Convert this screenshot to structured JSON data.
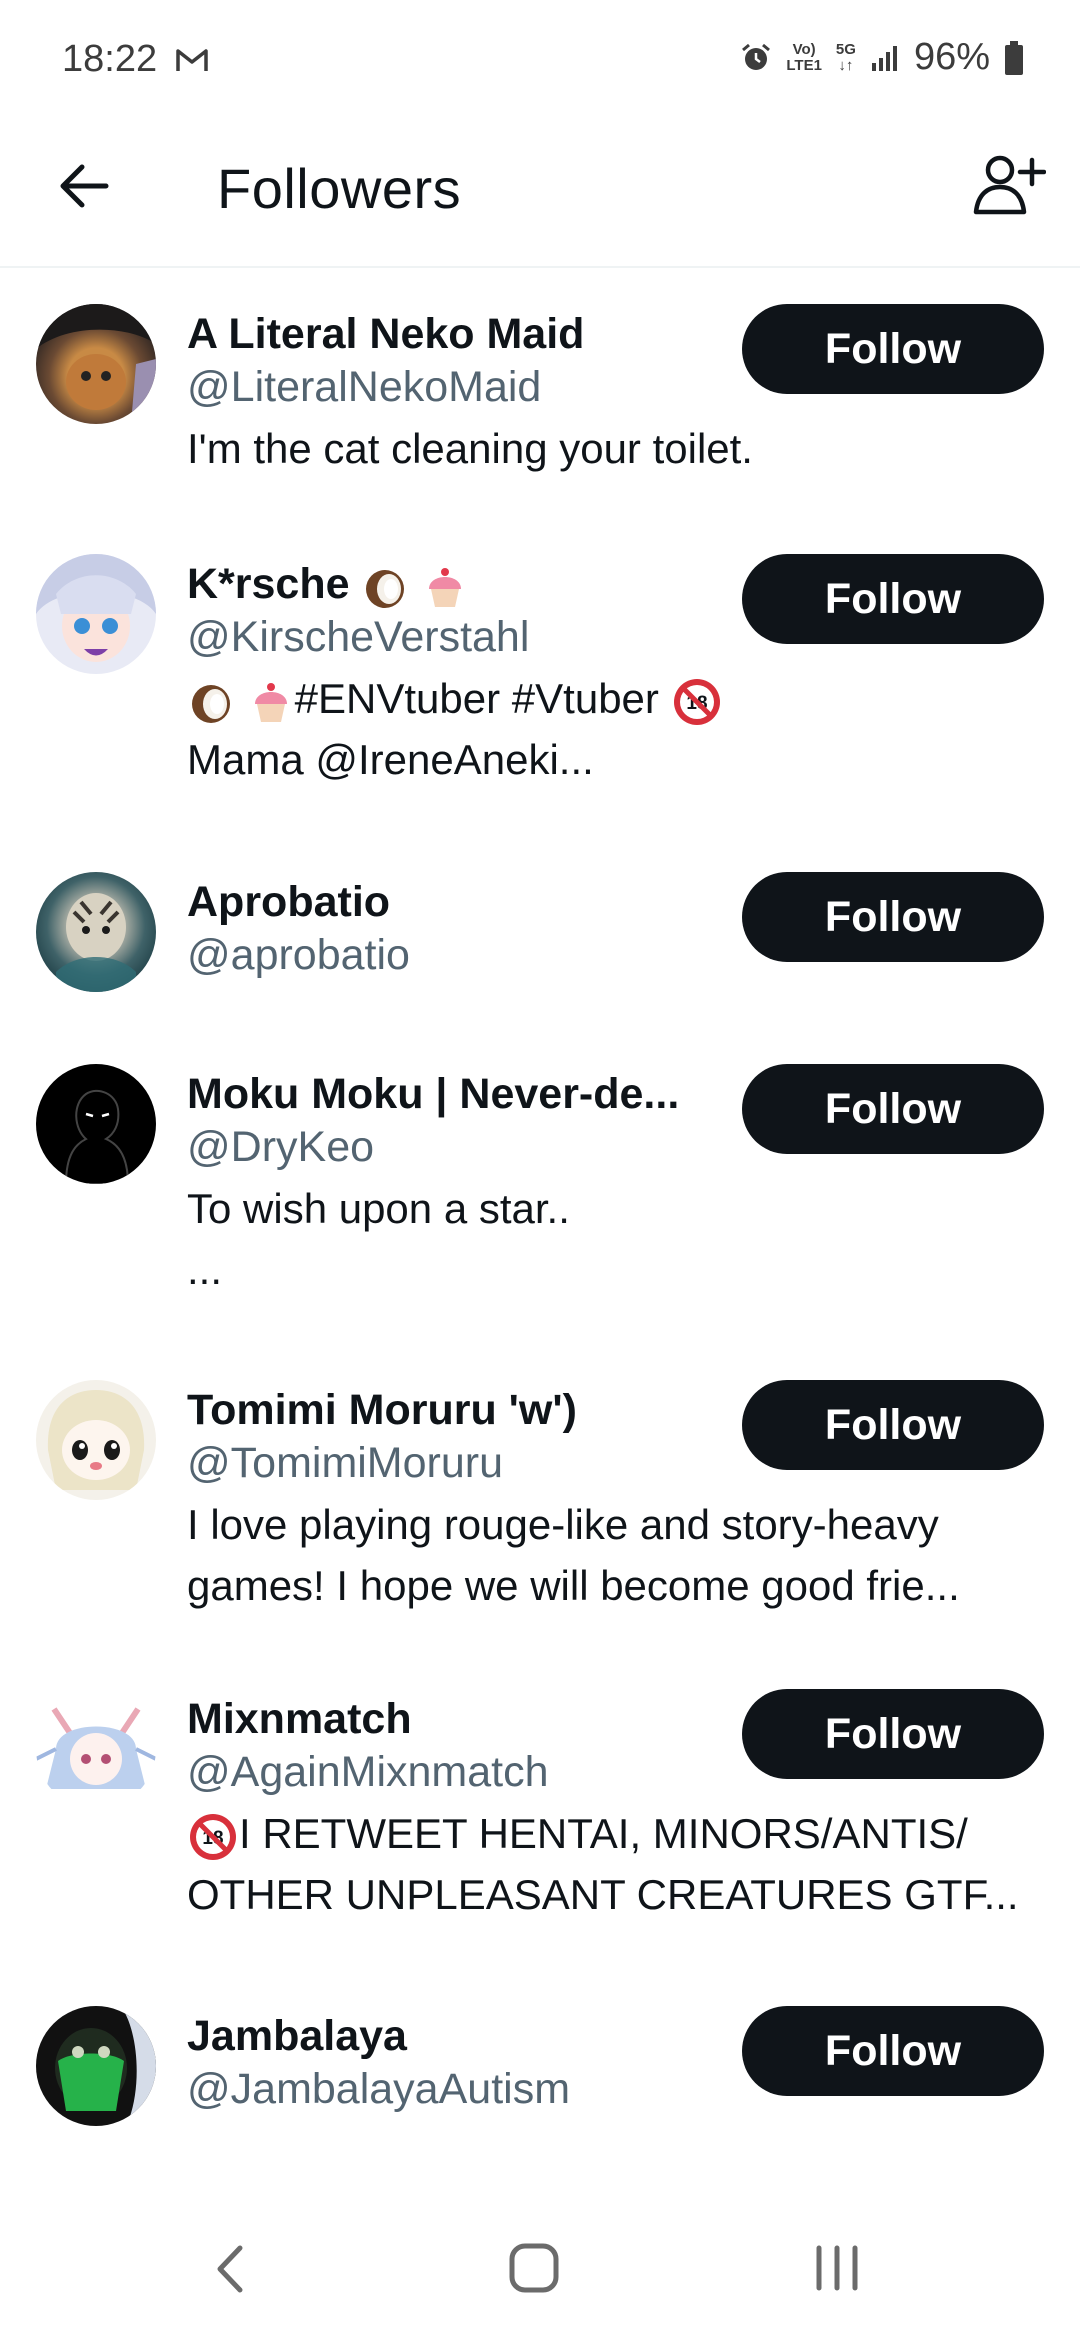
{
  "status_bar": {
    "time": "18:22",
    "volte": "Vo)\nLTE1",
    "network": "5G",
    "battery": "96%"
  },
  "header": {
    "title": "Followers",
    "back_icon": "arrow-left-icon",
    "action_icon": "add-user-icon"
  },
  "follow_label": "Follow",
  "followers": [
    {
      "name": "A Literal Neko Maid",
      "handle": "@LiteralNekoMaid",
      "bio": [
        "I'm the cat cleaning your toilet."
      ]
    },
    {
      "name": "K*rsche",
      "handle": "@KirscheVerstahl",
      "bio_line1": "#ENVtuber #Vtuber",
      "bio_line2": "Mama @IreneAneki..."
    },
    {
      "name": "Aprobatio",
      "handle": "@aprobatio",
      "bio": []
    },
    {
      "name": "Moku Moku | Never-de...",
      "handle": "@DryKeo",
      "bio": [
        "To wish upon a star..",
        "..."
      ]
    },
    {
      "name": "Tomimi Moruru 'w')",
      "handle": "@TomimiMoruru",
      "bio": [
        "I love playing rouge-like and story-heavy",
        "games! I hope we will become good frie..."
      ]
    },
    {
      "name": "Mixnmatch",
      "handle": "@AgainMixnmatch",
      "bio_line1": "I RETWEET HENTAI, MINORS/ANTIS/",
      "bio_line2": "OTHER UNPLEASANT CREATURES GTF..."
    },
    {
      "name": "Jambalaya",
      "handle": "@JambalayaAutism",
      "bio": []
    }
  ],
  "colors": {
    "text_primary": "#0f1419",
    "text_secondary": "#536471",
    "button_bg": "#0f1419",
    "button_text": "#ffffff"
  }
}
